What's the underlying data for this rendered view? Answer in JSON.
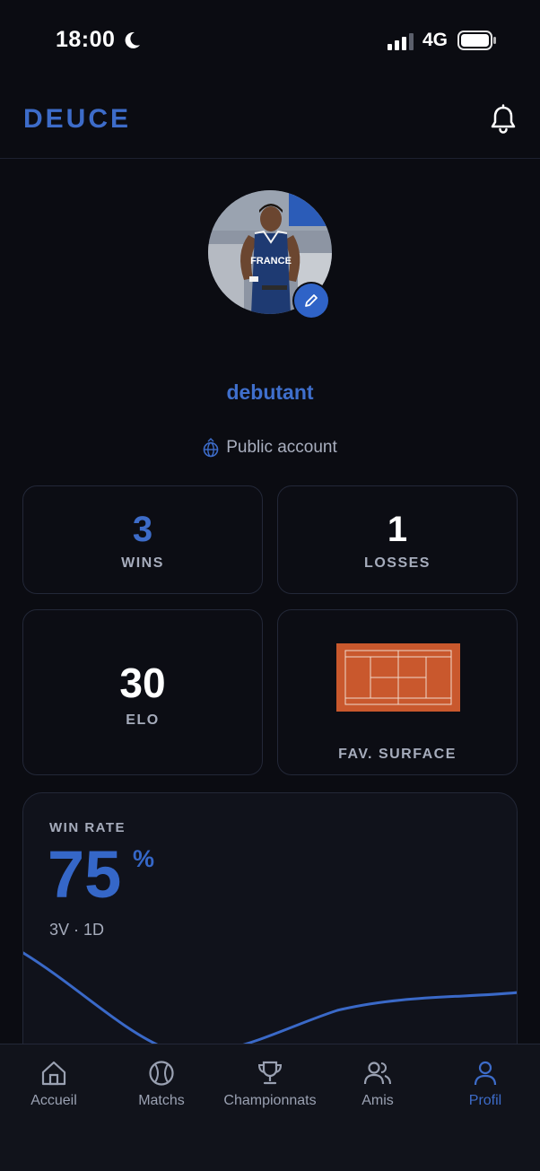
{
  "status": {
    "time": "18:00",
    "network": "4G"
  },
  "header": {
    "logo": "DEUCE"
  },
  "profile": {
    "username": "debutant",
    "account_type": "Public account",
    "jersey_text": "FRANCE"
  },
  "stats": {
    "wins": {
      "value": "3",
      "label": "WINS"
    },
    "losses": {
      "value": "1",
      "label": "LOSSES"
    },
    "elo": {
      "value": "30",
      "label": "ELO"
    },
    "surface": {
      "label": "FAV. SURFACE"
    }
  },
  "winrate": {
    "label": "WIN RATE",
    "value": "75",
    "unit": "%",
    "record": "3V · 1D"
  },
  "tabs": [
    {
      "label": "Accueil",
      "icon": "home-icon",
      "active": false
    },
    {
      "label": "Matchs",
      "icon": "tennis-ball-icon",
      "active": false
    },
    {
      "label": "Championnats",
      "icon": "trophy-icon",
      "active": false
    },
    {
      "label": "Amis",
      "icon": "friends-icon",
      "active": false
    },
    {
      "label": "Profil",
      "icon": "user-icon",
      "active": true
    }
  ],
  "colors": {
    "accent": "#3d6cc9",
    "background": "#0b0c12",
    "clay": "#c9582d"
  }
}
